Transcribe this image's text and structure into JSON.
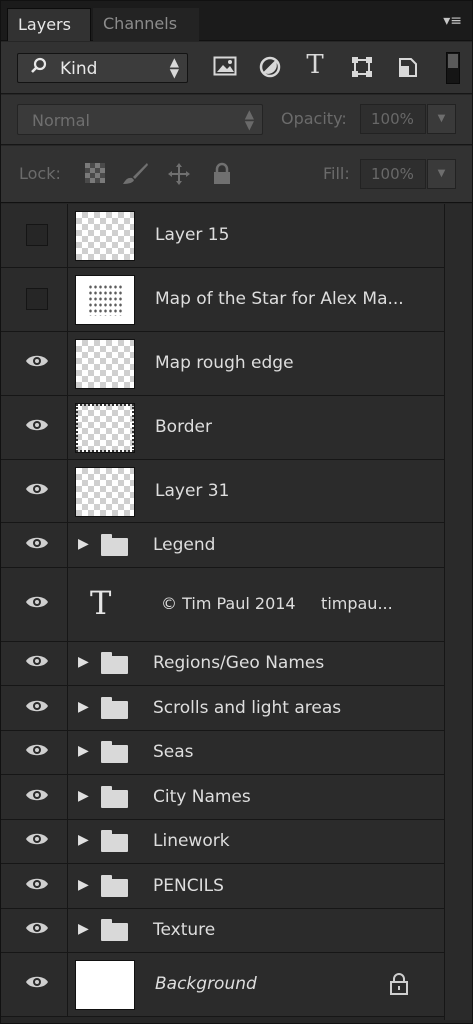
{
  "tabs": [
    {
      "label": "Layers"
    },
    {
      "label": "Channels"
    }
  ],
  "panel_menu_icon": "panel-menu-icon",
  "filter": {
    "search_icon": "⚲",
    "kind_label": "Kind",
    "arrows": "▲\n▼",
    "icons": [
      "image-filter-icon",
      "adjustment-filter-icon",
      "type-filter-icon",
      "shape-filter-icon",
      "smart-object-filter-icon"
    ],
    "type_glyph": "T"
  },
  "blend": {
    "mode": "Normal",
    "arrows": "▲\n▼",
    "opacity_label": "Opacity:",
    "opacity_value": "100%",
    "dropdown_arrow": "▼"
  },
  "lock": {
    "label": "Lock:",
    "fill_label": "Fill:",
    "fill_value": "100%",
    "dropdown_arrow": "▼"
  },
  "layers": [
    {
      "type": "pixel",
      "name": "Layer 15",
      "visible": false,
      "thumb": "transparent"
    },
    {
      "type": "pixel",
      "name": "Map of the Star for Alex Ma...",
      "visible": false,
      "thumb": "speckled"
    },
    {
      "type": "pixel",
      "name": "Map rough edge",
      "visible": true,
      "thumb": "transparent"
    },
    {
      "type": "pixel",
      "name": "Border",
      "visible": true,
      "thumb": "bordered"
    },
    {
      "type": "pixel",
      "name": "Layer 31",
      "visible": true,
      "thumb": "transparent"
    },
    {
      "type": "group",
      "name": "Legend",
      "visible": true
    },
    {
      "type": "text",
      "name": "© Tim Paul 2014     timpau...",
      "visible": true
    },
    {
      "type": "group",
      "name": "Regions/Geo Names",
      "visible": true
    },
    {
      "type": "group",
      "name": "Scrolls and light areas",
      "visible": true
    },
    {
      "type": "group",
      "name": "Seas",
      "visible": true
    },
    {
      "type": "group",
      "name": "City Names",
      "visible": true
    },
    {
      "type": "group",
      "name": "Linework",
      "visible": true
    },
    {
      "type": "group",
      "name": "PENCILS",
      "visible": true
    },
    {
      "type": "group",
      "name": "Texture",
      "visible": true
    },
    {
      "type": "background",
      "name": "Background",
      "visible": true,
      "locked": true
    }
  ],
  "glyphs": {
    "eye": "👁",
    "expand": "▶",
    "text_layer": "T",
    "lock": "🔒"
  }
}
